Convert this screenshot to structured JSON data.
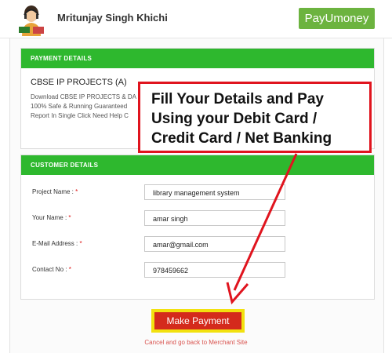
{
  "merchant": {
    "name": "Mritunjay Singh Khichi"
  },
  "brand": {
    "logo_text": "PayUmoney",
    "accent": "#6cb33f",
    "section_color": "#2eb82e"
  },
  "payment_details": {
    "heading": "PAYMENT DETAILS",
    "product_name": "CBSE IP PROJECTS (A)",
    "description_lines": [
      "Download CBSE IP PROJECTS & DA",
      "100% Safe & Running Guaranteed",
      "Report In Single Click Need Help C"
    ]
  },
  "customer_details": {
    "heading": "CUSTOMER DETAILS",
    "fields": [
      {
        "label": "Project Name :",
        "value": "library management system"
      },
      {
        "label": "Your Name :",
        "value": "amar singh"
      },
      {
        "label": "E-Mail Address :",
        "value": "amar@gmail.com"
      },
      {
        "label": "Contact No :",
        "value": "978459662"
      }
    ],
    "required_mark": "*"
  },
  "callout": {
    "lines": [
      "Fill Your Details and Pay",
      "Using your Debit Card /",
      "Credit Card / Net Banking"
    ],
    "color": "#e0141e"
  },
  "actions": {
    "pay_button": "Make Payment",
    "cancel_link": "Cancel and go back to Merchant Site",
    "button_color": "#d42a1c",
    "button_border": "#f2e10f"
  }
}
